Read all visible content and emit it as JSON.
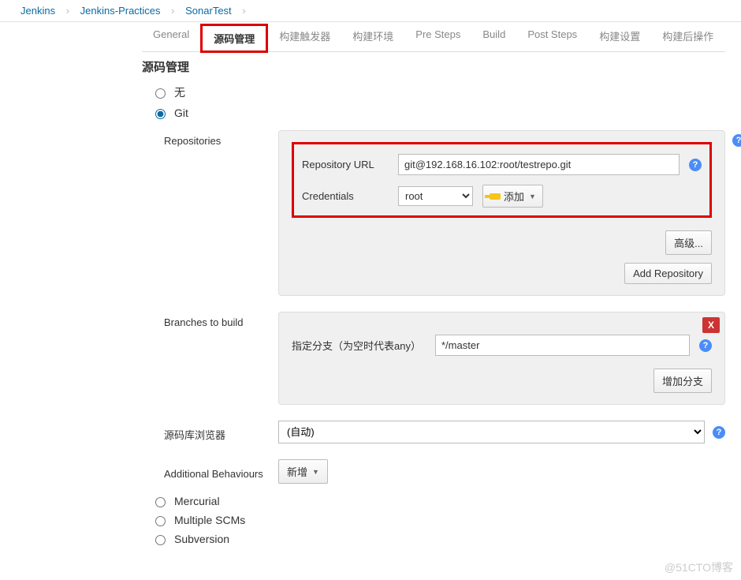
{
  "breadcrumb": {
    "items": [
      "Jenkins",
      "Jenkins-Practices",
      "SonarTest"
    ]
  },
  "tabs": [
    {
      "label": "General"
    },
    {
      "label": "源码管理",
      "active": true
    },
    {
      "label": "构建触发器"
    },
    {
      "label": "构建环境"
    },
    {
      "label": "Pre Steps"
    },
    {
      "label": "Build"
    },
    {
      "label": "Post Steps"
    },
    {
      "label": "构建设置"
    },
    {
      "label": "构建后操作"
    }
  ],
  "section_title": "源码管理",
  "scm_options": {
    "none": "无",
    "git": "Git",
    "mercurial": "Mercurial",
    "multiple": "Multiple SCMs",
    "subversion": "Subversion"
  },
  "git": {
    "repositories_label": "Repositories",
    "repo_url_label": "Repository URL",
    "repo_url_value": "git@192.168.16.102:root/testrepo.git",
    "credentials_label": "Credentials",
    "credentials_value": "root",
    "add_label": "添加",
    "advanced_label": "高级...",
    "add_repository_label": "Add Repository",
    "branches_label": "Branches to build",
    "branch_spec_label": "指定分支（为空时代表any）",
    "branch_value": "*/master",
    "add_branch_label": "增加分支",
    "browser_label": "源码库浏览器",
    "browser_value": "(自动)",
    "behaviours_label": "Additional Behaviours",
    "behaviours_add_label": "新增",
    "delete_label": "X"
  },
  "help_text": "?",
  "watermark": "@51CTO博客"
}
